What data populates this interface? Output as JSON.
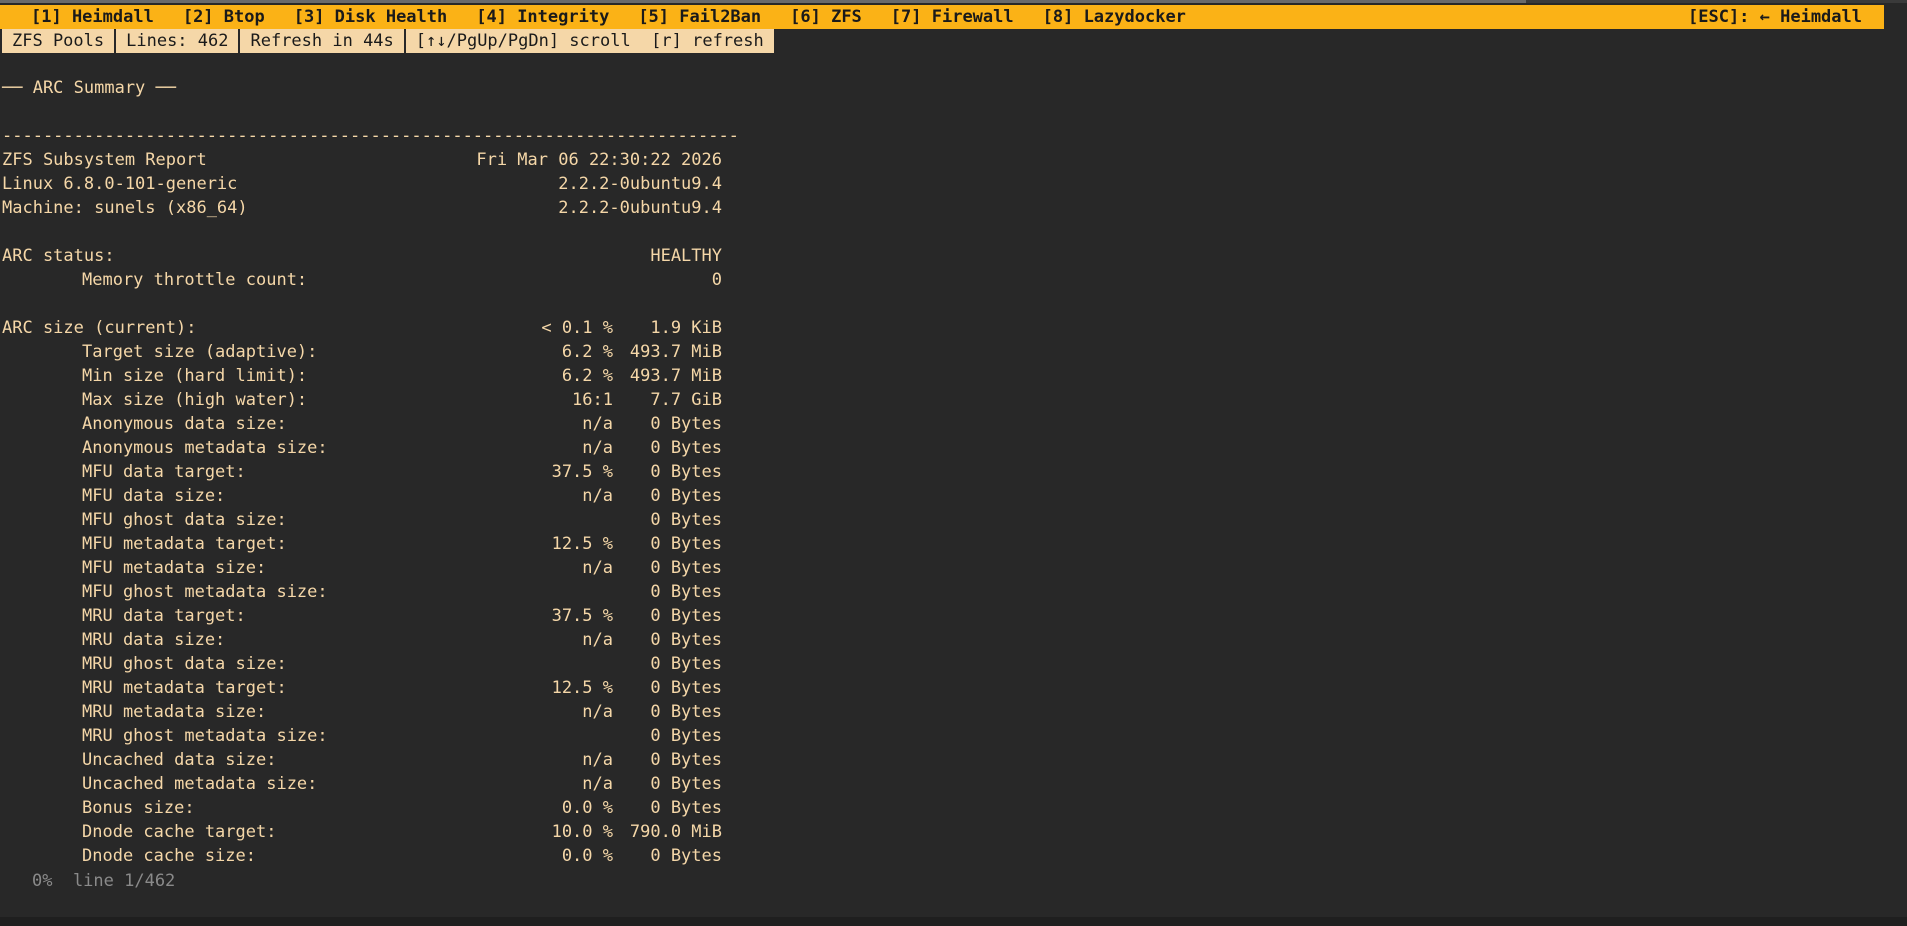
{
  "top_progress": 0.8,
  "tabs": [
    {
      "label": "[1] Heimdall"
    },
    {
      "label": "[2] Btop"
    },
    {
      "label": "[3] Disk Health"
    },
    {
      "label": "[4] Integrity"
    },
    {
      "label": "[5] Fail2Ban"
    },
    {
      "label": "[6] ZFS"
    },
    {
      "label": "[7] Firewall"
    },
    {
      "label": "[8] Lazydocker"
    }
  ],
  "esc_label": "[ESC]: ← Heimdall",
  "status": {
    "view": "ZFS Pools",
    "lines": "Lines: 462",
    "refresh": "Refresh in 44s",
    "keys": "[↑↓/PgUp/PgDn] scroll  [r] refresh"
  },
  "section_heading": "── ARC Summary ──",
  "separator": "------------------------------------------------------------------------",
  "report": {
    "title": "ZFS Subsystem Report",
    "date": "Fri Mar 06 22:30:22 2026",
    "kernel_label": "Linux 6.8.0-101-generic",
    "kernel_value": "2.2.2-0ubuntu9.4",
    "machine_label": "Machine: sunels (x86_64)",
    "machine_value": "2.2.2-0ubuntu9.4"
  },
  "arc_status": {
    "label": "ARC status:",
    "value": "HEALTHY",
    "throttle_label": "Memory throttle count:",
    "throttle_value": "0"
  },
  "arc_size_rows": [
    {
      "label": "ARC size (current):",
      "pct": "< 0.1 %",
      "value": "1.9 KiB",
      "indent": false
    },
    {
      "label": "Target size (adaptive):",
      "pct": "6.2 %",
      "value": "493.7 MiB",
      "indent": true
    },
    {
      "label": "Min size (hard limit):",
      "pct": "6.2 %",
      "value": "493.7 MiB",
      "indent": true
    },
    {
      "label": "Max size (high water):",
      "pct": "16:1",
      "value": "7.7 GiB",
      "indent": true
    },
    {
      "label": "Anonymous data size:",
      "pct": "n/a",
      "value": "0 Bytes",
      "indent": true
    },
    {
      "label": "Anonymous metadata size:",
      "pct": "n/a",
      "value": "0 Bytes",
      "indent": true
    },
    {
      "label": "MFU data target:",
      "pct": "37.5 %",
      "value": "0 Bytes",
      "indent": true
    },
    {
      "label": "MFU data size:",
      "pct": "n/a",
      "value": "0 Bytes",
      "indent": true
    },
    {
      "label": "MFU ghost data size:",
      "pct": "",
      "value": "0 Bytes",
      "indent": true
    },
    {
      "label": "MFU metadata target:",
      "pct": "12.5 %",
      "value": "0 Bytes",
      "indent": true
    },
    {
      "label": "MFU metadata size:",
      "pct": "n/a",
      "value": "0 Bytes",
      "indent": true
    },
    {
      "label": "MFU ghost metadata size:",
      "pct": "",
      "value": "0 Bytes",
      "indent": true
    },
    {
      "label": "MRU data target:",
      "pct": "37.5 %",
      "value": "0 Bytes",
      "indent": true
    },
    {
      "label": "MRU data size:",
      "pct": "n/a",
      "value": "0 Bytes",
      "indent": true
    },
    {
      "label": "MRU ghost data size:",
      "pct": "",
      "value": "0 Bytes",
      "indent": true
    },
    {
      "label": "MRU metadata target:",
      "pct": "12.5 %",
      "value": "0 Bytes",
      "indent": true
    },
    {
      "label": "MRU metadata size:",
      "pct": "n/a",
      "value": "0 Bytes",
      "indent": true
    },
    {
      "label": "MRU ghost metadata size:",
      "pct": "",
      "value": "0 Bytes",
      "indent": true
    },
    {
      "label": "Uncached data size:",
      "pct": "n/a",
      "value": "0 Bytes",
      "indent": true
    },
    {
      "label": "Uncached metadata size:",
      "pct": "n/a",
      "value": "0 Bytes",
      "indent": true
    },
    {
      "label": "Bonus size:",
      "pct": "0.0 %",
      "value": "0 Bytes",
      "indent": true
    },
    {
      "label": "Dnode cache target:",
      "pct": "10.0 %",
      "value": "790.0 MiB",
      "indent": true
    },
    {
      "label": "Dnode cache size:",
      "pct": "0.0 %",
      "value": "0 Bytes",
      "indent": true
    }
  ],
  "footer": "0%  line 1/462",
  "colors": {
    "tabbar_bg": "#fbb216",
    "statusbar_bg": "#f5d7a8",
    "text": "#f5d7a8",
    "background": "#282828",
    "footer_text": "#8a8a8a"
  }
}
